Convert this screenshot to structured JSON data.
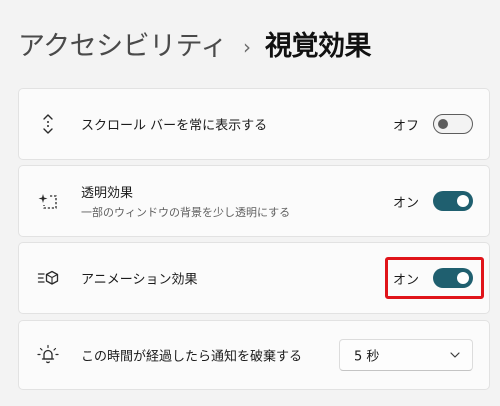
{
  "breadcrumb": {
    "parent": "アクセシビリティ",
    "separator": "›",
    "current": "視覚効果"
  },
  "settings": [
    {
      "icon": "scrollbar-icon",
      "title": "スクロール バーを常に表示する",
      "subtitle": "",
      "state_label": "オフ",
      "on": false
    },
    {
      "icon": "transparency-icon",
      "title": "透明効果",
      "subtitle": "一部のウィンドウの背景を少し透明にする",
      "state_label": "オン",
      "on": true
    },
    {
      "icon": "animation-icon",
      "title": "アニメーション効果",
      "subtitle": "",
      "state_label": "オン",
      "on": true
    }
  ],
  "notification_timeout": {
    "icon": "notification-bell-icon",
    "label": "この時間が経過したら通知を破棄する",
    "selected": "5 秒"
  },
  "colors": {
    "accent": "#1f5f6f",
    "highlight": "#e0141a"
  }
}
